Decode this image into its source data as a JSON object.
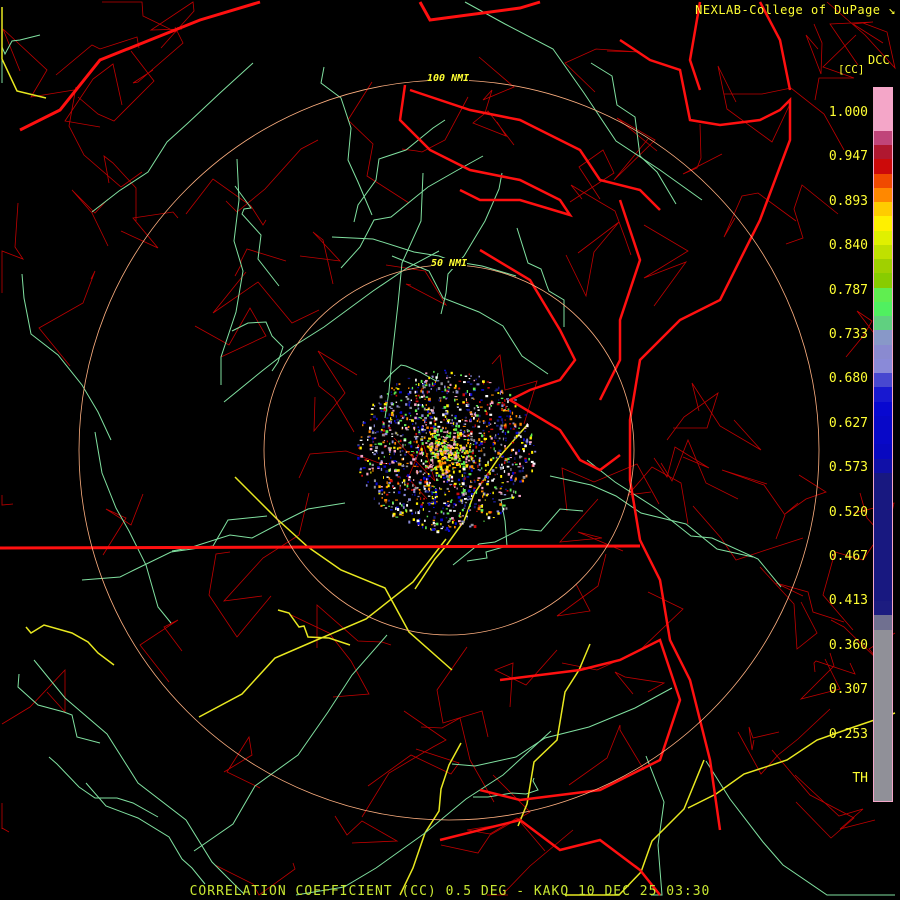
{
  "credit": "NEXLAB-College of DuPage",
  "credit_icon": "resize-corner-icon",
  "product_code": "DCC",
  "units": "[CC]",
  "legend": {
    "labels": [
      "1.000",
      "0.947",
      "0.893",
      "0.840",
      "0.787",
      "0.733",
      "0.680",
      "0.627",
      "0.573",
      "0.520",
      "0.467",
      "0.413",
      "0.360",
      "0.307",
      "0.253",
      "TH"
    ],
    "colors": [
      "#f4a6c8",
      "#f4a6c8",
      "#f4a6c8",
      "#c0457a",
      "#b01830",
      "#cc0a0a",
      "#f04a00",
      "#ff8800",
      "#ffcc00",
      "#fff000",
      "#e0f000",
      "#c0e000",
      "#a0d000",
      "#88cc00",
      "#60ee50",
      "#50f060",
      "#60d080",
      "#8898c8",
      "#8a8ad0",
      "#8a8ad8",
      "#4848d0",
      "#1818d0",
      "#0808d0",
      "#0808c8",
      "#0808c8",
      "#0808c0",
      "#1010a8",
      "#181880",
      "#181880",
      "#181880",
      "#181880",
      "#181880",
      "#181880",
      "#181880",
      "#181880",
      "#181880",
      "#1c1c80",
      "#707090",
      "#909098",
      "#909098",
      "#909098",
      "#909098",
      "#909098",
      "#909098",
      "#909098",
      "#909098",
      "#909098",
      "#909098",
      "#909098",
      "#909098"
    ]
  },
  "range_rings": [
    "50 NMI",
    "100 NMI"
  ],
  "caption": "CORRELATION COEFFICIENT (CC) 0.5 DEG - KAKQ 10 DEC 25 03:30"
}
